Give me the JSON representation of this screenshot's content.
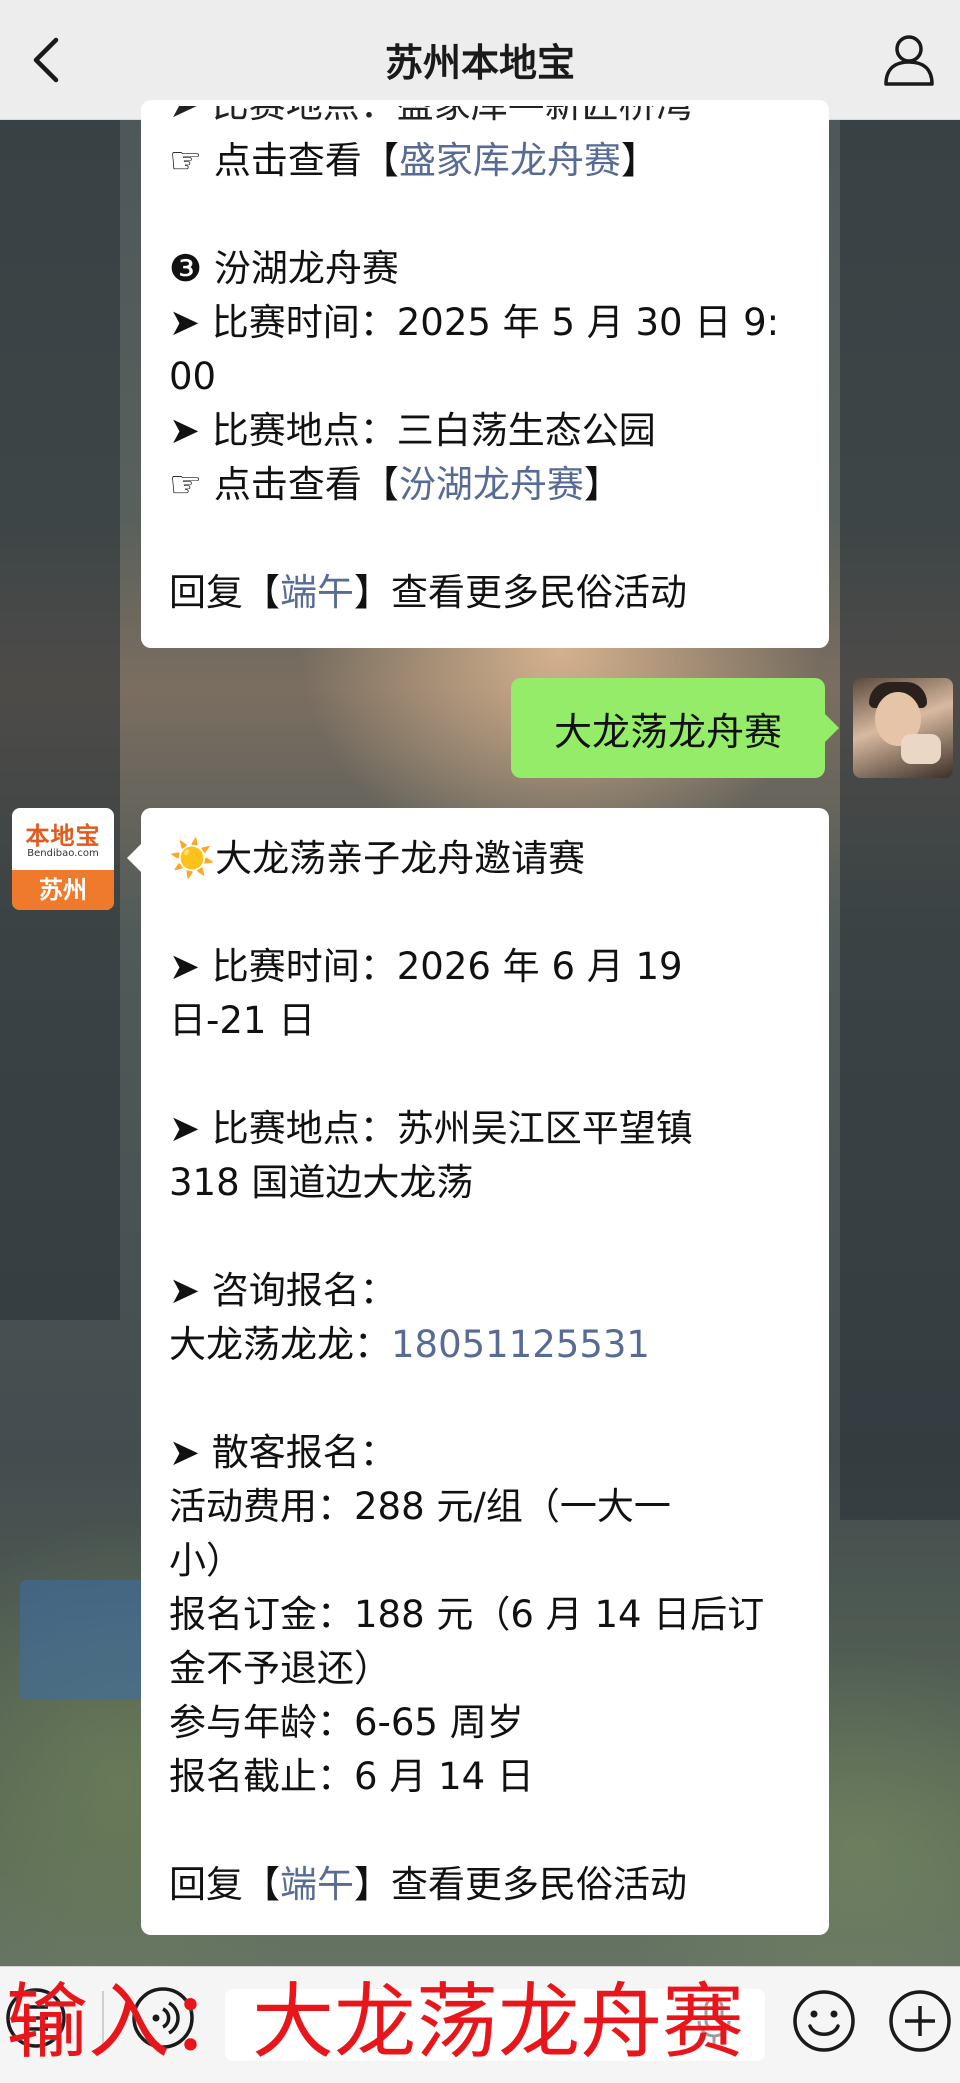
{
  "header": {
    "title": "苏州本地宝"
  },
  "message1": {
    "cut_line": "➤ 比赛地点：盛家库—新匠桥湾",
    "link1_prefix": "☞ 点击查看【",
    "link1_text": "盛家库龙舟赛",
    "link1_suffix": "】",
    "event3_title": "❸ 汾湖龙舟赛",
    "event3_time_a": "➤ 比赛时间：2025 年 5 月 30 日 9:",
    "event3_time_b": "00",
    "event3_place": "➤ 比赛地点：三白荡生态公园",
    "link2_prefix": "☞ 点击查看【",
    "link2_text": "汾湖龙舟赛",
    "link2_suffix": "】",
    "reply_prefix": "回复【",
    "reply_link": "端午",
    "reply_suffix": "】查看更多民俗活动"
  },
  "message2": {
    "text": "大龙荡龙舟赛"
  },
  "message3": {
    "title": "☀️大龙荡亲子龙舟邀请赛",
    "time_a": "➤ 比赛时间：2026 年 6 月 19",
    "time_b": "日-21 日",
    "place_a": "➤ 比赛地点：苏州吴江区平望镇",
    "place_b": "318 国道边大龙荡",
    "consult_label": "➤ 咨询报名：",
    "contact_prefix": "大龙荡龙龙：",
    "contact_phone": "18051125531",
    "walkin_label": "➤ 散客报名：",
    "fee_a": "活动费用：288 元/组（一大一",
    "fee_b": "小）",
    "deposit_a": "报名订金：188 元（6 月 14 日后订",
    "deposit_b": "金不予退还）",
    "age": "参与年龄：6-65 周岁",
    "deadline": "报名截止：6 月 14 日",
    "reply_prefix": "回复【",
    "reply_link": "端午",
    "reply_suffix": "】查看更多民俗活动"
  },
  "bot_avatar": {
    "logo_text": "本地宝",
    "logo_sub": "Bendibao.com",
    "city": "苏州"
  },
  "overlay": {
    "hint": "输入：大龙荡龙舟赛"
  },
  "colors": {
    "link": "#576b95",
    "self_bubble": "#95ec69",
    "hint": "#e8161b"
  }
}
